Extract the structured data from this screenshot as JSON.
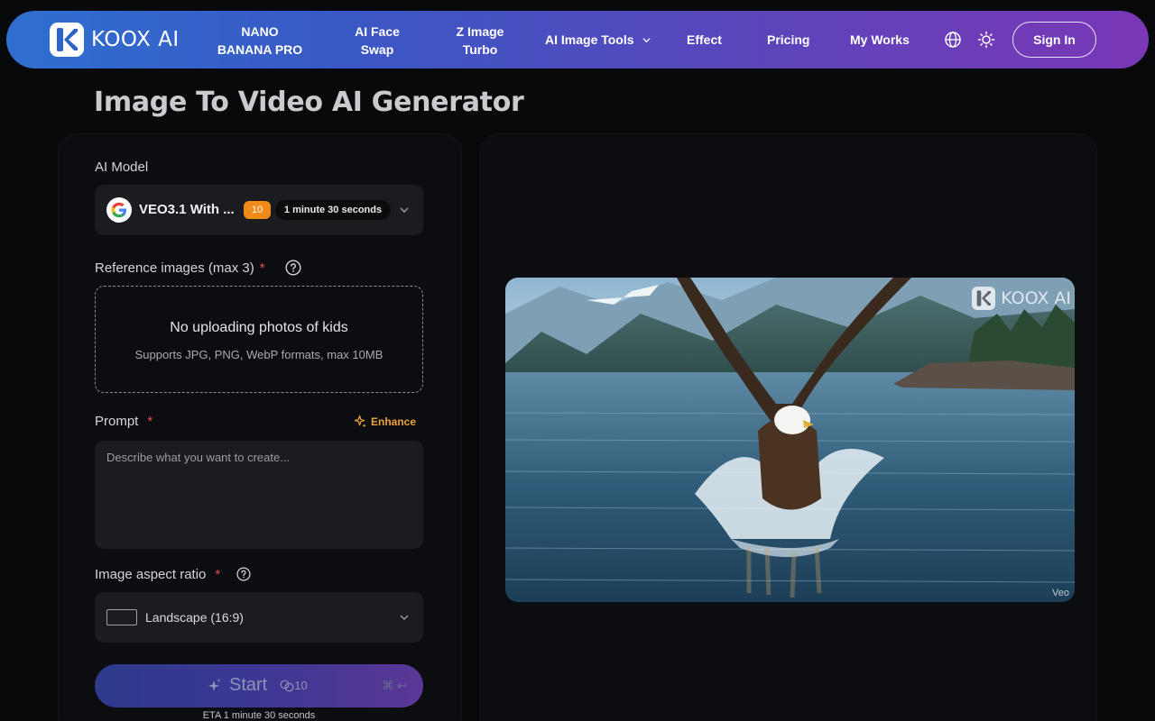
{
  "nav": {
    "brand": "KOOX AI",
    "links": {
      "nano_line1": "NANO",
      "nano_line2": "BANANA PRO",
      "face_line1": "AI Face",
      "face_line2": "Swap",
      "zimage_line1": "Z Image",
      "zimage_line2": "Turbo",
      "image_tools": "AI Image Tools",
      "effect": "Effect",
      "pricing": "Pricing",
      "my_works": "My Works"
    },
    "signin": "Sign In"
  },
  "page": {
    "title": "Image To Video AI Generator"
  },
  "form": {
    "model": {
      "label": "AI Model",
      "selected": "VEO3.1 With ...",
      "credits": "10",
      "duration": "1 minute 30 seconds"
    },
    "reference": {
      "label": "Reference images (max 3)",
      "required": "*",
      "title": "No uploading photos of kids",
      "subtitle": "Supports JPG, PNG, WebP formats, max 10MB"
    },
    "prompt": {
      "label": "Prompt",
      "required": "*",
      "enhance": "Enhance",
      "placeholder": "Describe what you want to create...",
      "value": ""
    },
    "aspect": {
      "label": "Image aspect ratio",
      "required": "*",
      "selected": "Landscape (16:9)"
    },
    "start": {
      "label": "Start",
      "cost": "10",
      "shortcut": "⌘ ↩"
    },
    "eta": "ETA 1 minute 30 seconds"
  },
  "preview": {
    "watermark": "KOOX AI",
    "corner_mark": "Veo"
  },
  "colors": {
    "nav_gradient_start": "#2f6fd0",
    "nav_gradient_end": "#7a37b6",
    "accent_orange": "#f08b19",
    "required_red": "#e2504b"
  }
}
